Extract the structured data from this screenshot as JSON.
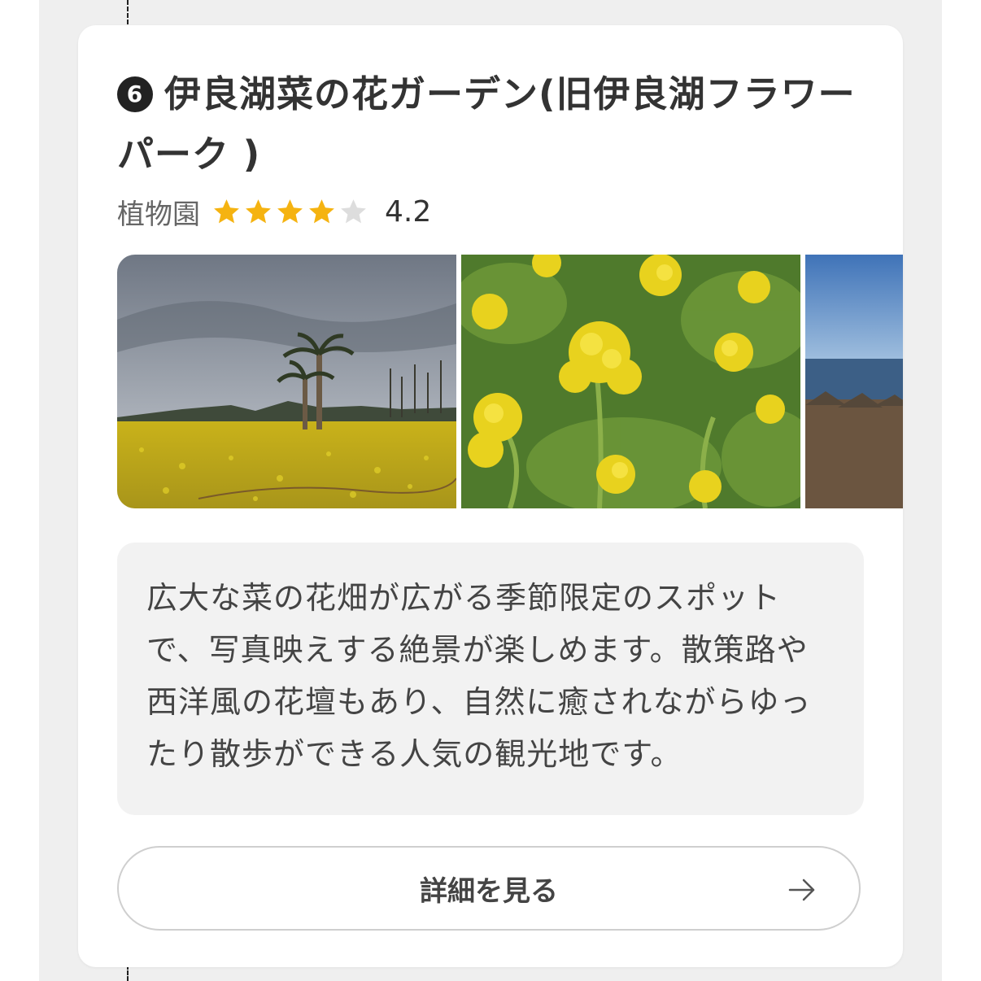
{
  "spot": {
    "number": "6",
    "name": "伊良湖菜の花ガーデン(旧伊良湖フラワーパーク )",
    "category": "植物園",
    "rating": 4.2,
    "rating_text": "4.2",
    "stars_filled": 4,
    "stars_total": 5
  },
  "description": "広大な菜の花畑が広がる季節限定のスポットで、写真映えする絶景が楽しめます。散策路や西洋風の花壇もあり、自然に癒されながらゆったり散歩ができる人気の観光地です。",
  "detail_button": {
    "label": "詳細を見る",
    "icon": "arrow-right-icon"
  },
  "gallery": {
    "photos": [
      {
        "subject": "palm-trees-canola-field"
      },
      {
        "subject": "canola-flowers-closeup"
      },
      {
        "subject": "seaside-shore"
      }
    ]
  },
  "colors": {
    "star_filled": "#f5b311",
    "star_empty": "#dddddd",
    "badge": "#222222",
    "text": "#333333"
  }
}
